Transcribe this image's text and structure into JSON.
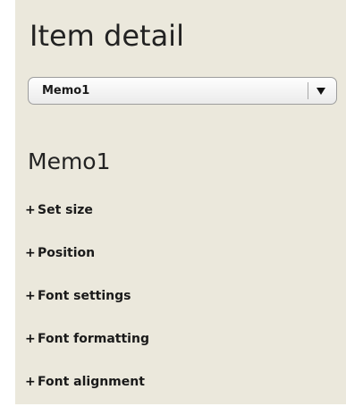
{
  "panel": {
    "title": "Item detail"
  },
  "selector": {
    "selected": "Memo1",
    "arrow_icon": "triangle-down-icon"
  },
  "item": {
    "heading": "Memo1"
  },
  "sections": [
    {
      "icon": "+",
      "label": "Set size"
    },
    {
      "icon": "+",
      "label": "Position"
    },
    {
      "icon": "+",
      "label": "Font settings"
    },
    {
      "icon": "+",
      "label": "Font formatting"
    },
    {
      "icon": "+",
      "label": "Font alignment"
    }
  ],
  "colors": {
    "panel_background": "#ebe8dc",
    "text": "#1a1a1a"
  }
}
